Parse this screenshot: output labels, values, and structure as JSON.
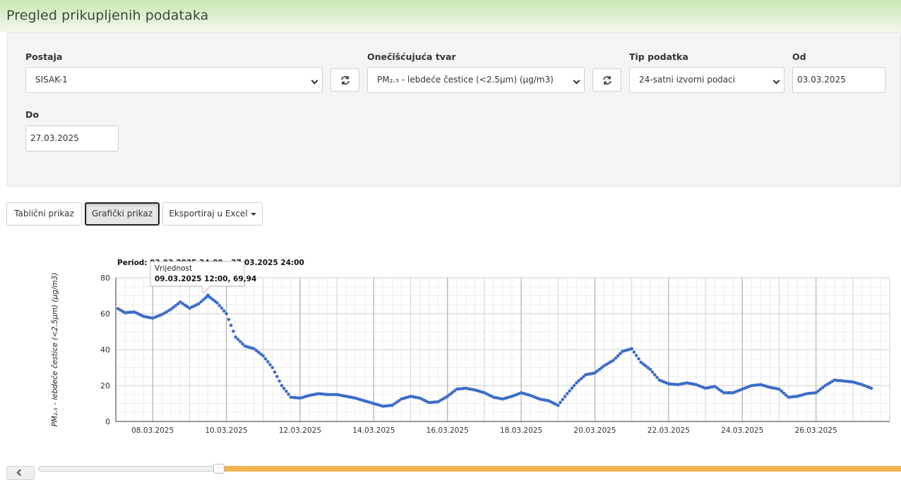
{
  "page": {
    "title": "Pregled prikupljenih podataka"
  },
  "filters": {
    "station_label": "Postaja",
    "station_value": "SISAK-1",
    "pollutant_label": "Onečišćujuća tvar",
    "pollutant_value": "PM₂.₅ - lebdeće čestice (<2.5µm) (µg/m3)",
    "datatype_label": "Tip podatka",
    "datatype_value": "24-satni izvorni podaci",
    "from_label": "Od",
    "from_value": "03.03.2025",
    "to_label": "Do",
    "to_value": "27.03.2025"
  },
  "tabs": {
    "table": "Tablični prikaz",
    "chart": "Grafički prikaz",
    "export": "Eksportiraj u Excel"
  },
  "colors": {
    "series": "#3a6cc8",
    "accent": "#f0b34d",
    "header": "#cfe9bb"
  },
  "chart_data": {
    "type": "scatter",
    "title": "Period: 03.03.2025 24:00 - 27.03.2025 24:00",
    "ylabel": "PM₂.₅ - lebdeće čestice (<2.5µm) (µg/m3)",
    "xlabel": "",
    "x_ticks": [
      "08.03.2025",
      "10.03.2025",
      "12.03.2025",
      "14.03.2025",
      "16.03.2025",
      "18.03.2025",
      "20.03.2025",
      "22.03.2025",
      "24.03.2025",
      "26.03.2025"
    ],
    "y_ticks": [
      0,
      20,
      40,
      60,
      80
    ],
    "ylim": [
      0,
      80
    ],
    "xlim": [
      "07.03.2025 01:00",
      "27.03.2025 24:00"
    ],
    "grid": true,
    "tooltip": {
      "title": "Vrijednost",
      "text": "09.03.2025 12:00, 69,94"
    },
    "series": [
      {
        "points": [
          [
            "07.03.2025 00:00",
            63.5
          ],
          [
            "07.03.2025 06:00",
            60.5
          ],
          [
            "07.03.2025 12:00",
            61.0
          ],
          [
            "07.03.2025 18:00",
            58.5
          ],
          [
            "08.03.2025 00:00",
            57.5
          ],
          [
            "08.03.2025 06:00",
            59.5
          ],
          [
            "08.03.2025 12:00",
            62.5
          ],
          [
            "08.03.2025 18:00",
            66.5
          ],
          [
            "09.03.2025 00:00",
            63.0
          ],
          [
            "09.03.2025 06:00",
            65.5
          ],
          [
            "09.03.2025 12:00",
            69.94
          ],
          [
            "09.03.2025 18:00",
            66.0
          ],
          [
            "10.03.2025 00:00",
            60.0
          ],
          [
            "10.03.2025 06:00",
            47.0
          ],
          [
            "10.03.2025 12:00",
            42.0
          ],
          [
            "10.03.2025 18:00",
            40.5
          ],
          [
            "11.03.2025 00:00",
            36.5
          ],
          [
            "11.03.2025 06:00",
            30.0
          ],
          [
            "11.03.2025 12:00",
            20.0
          ],
          [
            "11.03.2025 18:00",
            13.5
          ],
          [
            "12.03.2025 00:00",
            13.0
          ],
          [
            "12.03.2025 06:00",
            14.5
          ],
          [
            "12.03.2025 12:00",
            15.5
          ],
          [
            "12.03.2025 18:00",
            15.0
          ],
          [
            "13.03.2025 00:00",
            15.0
          ],
          [
            "13.03.2025 06:00",
            14.0
          ],
          [
            "13.03.2025 12:00",
            13.0
          ],
          [
            "13.03.2025 18:00",
            11.5
          ],
          [
            "14.03.2025 00:00",
            10.0
          ],
          [
            "14.03.2025 06:00",
            8.5
          ],
          [
            "14.03.2025 12:00",
            9.0
          ],
          [
            "14.03.2025 18:00",
            12.5
          ],
          [
            "15.03.2025 00:00",
            14.0
          ],
          [
            "15.03.2025 06:00",
            13.0
          ],
          [
            "15.03.2025 12:00",
            10.5
          ],
          [
            "15.03.2025 18:00",
            11.0
          ],
          [
            "16.03.2025 00:00",
            14.0
          ],
          [
            "16.03.2025 06:00",
            18.0
          ],
          [
            "16.03.2025 12:00",
            18.5
          ],
          [
            "16.03.2025 18:00",
            17.5
          ],
          [
            "17.03.2025 00:00",
            16.0
          ],
          [
            "17.03.2025 06:00",
            13.5
          ],
          [
            "17.03.2025 12:00",
            12.5
          ],
          [
            "17.03.2025 18:00",
            14.0
          ],
          [
            "18.03.2025 00:00",
            16.0
          ],
          [
            "18.03.2025 06:00",
            14.5
          ],
          [
            "18.03.2025 12:00",
            12.5
          ],
          [
            "18.03.2025 18:00",
            11.5
          ],
          [
            "19.03.2025 00:00",
            9.0
          ],
          [
            "19.03.2025 06:00",
            15.5
          ],
          [
            "19.03.2025 12:00",
            21.5
          ],
          [
            "19.03.2025 18:00",
            26.0
          ],
          [
            "20.03.2025 00:00",
            27.0
          ],
          [
            "20.03.2025 06:00",
            31.0
          ],
          [
            "20.03.2025 12:00",
            34.0
          ],
          [
            "20.03.2025 18:00",
            39.0
          ],
          [
            "21.03.2025 00:00",
            40.5
          ],
          [
            "21.03.2025 06:00",
            33.0
          ],
          [
            "21.03.2025 12:00",
            29.0
          ],
          [
            "21.03.2025 18:00",
            23.0
          ],
          [
            "22.03.2025 00:00",
            21.0
          ],
          [
            "22.03.2025 06:00",
            20.5
          ],
          [
            "22.03.2025 12:00",
            21.5
          ],
          [
            "22.03.2025 18:00",
            20.5
          ],
          [
            "23.03.2025 00:00",
            18.5
          ],
          [
            "23.03.2025 06:00",
            19.5
          ],
          [
            "23.03.2025 12:00",
            16.0
          ],
          [
            "23.03.2025 18:00",
            16.0
          ],
          [
            "24.03.2025 00:00",
            18.0
          ],
          [
            "24.03.2025 06:00",
            20.0
          ],
          [
            "24.03.2025 12:00",
            20.5
          ],
          [
            "24.03.2025 18:00",
            19.0
          ],
          [
            "25.03.2025 00:00",
            18.0
          ],
          [
            "25.03.2025 06:00",
            13.5
          ],
          [
            "25.03.2025 12:00",
            14.0
          ],
          [
            "25.03.2025 18:00",
            15.5
          ],
          [
            "26.03.2025 00:00",
            16.0
          ],
          [
            "26.03.2025 06:00",
            20.0
          ],
          [
            "26.03.2025 12:00",
            23.0
          ],
          [
            "26.03.2025 18:00",
            22.5
          ],
          [
            "27.03.2025 00:00",
            22.0
          ],
          [
            "27.03.2025 06:00",
            20.5
          ],
          [
            "27.03.2025 12:00",
            18.5
          ]
        ]
      }
    ]
  }
}
